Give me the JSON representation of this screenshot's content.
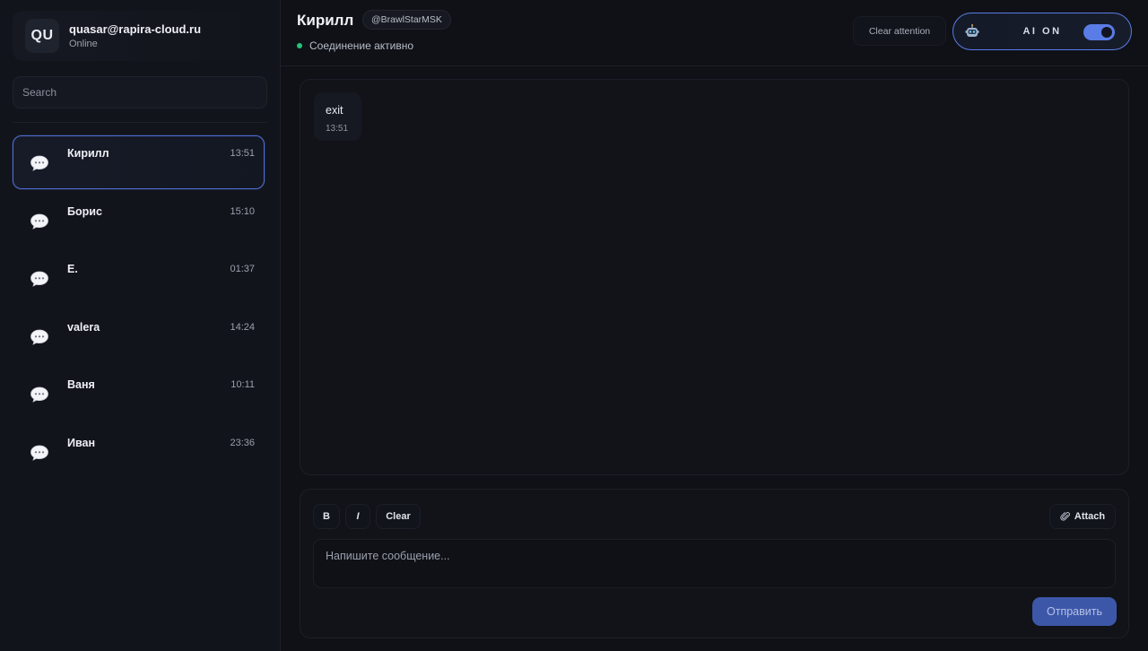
{
  "profile": {
    "avatar_initials": "QU",
    "email": "quasar@rapira-cloud.ru",
    "status": "Online"
  },
  "search": {
    "placeholder": "Search"
  },
  "chats": [
    {
      "name": "Кирилл",
      "time": "13:51",
      "active": true,
      "icon": "speech-bubble-icon"
    },
    {
      "name": "Борис",
      "time": "15:10",
      "active": false,
      "icon": "speech-bubble-icon"
    },
    {
      "name": "Е.",
      "time": "01:37",
      "active": false,
      "icon": "speech-bubble-icon"
    },
    {
      "name": "valera",
      "time": "14:24",
      "active": false,
      "icon": "speech-bubble-icon"
    },
    {
      "name": "Ваня",
      "time": "10:11",
      "active": false,
      "icon": "speech-bubble-icon"
    },
    {
      "name": "Иван",
      "time": "23:36",
      "active": false,
      "icon": "speech-bubble-icon"
    }
  ],
  "header": {
    "contact_name": "Кирилл",
    "handle": "@BrawlStarMSK",
    "connection_status": "Соединение активно",
    "clear_attention_label": "Clear attention",
    "ai_label": "AI ON",
    "ai_enabled": true
  },
  "messages": [
    {
      "text": "exit",
      "time": "13:51"
    }
  ],
  "composer": {
    "bold_label": "B",
    "italic_label": "I",
    "clear_label": "Clear",
    "attach_label": "Attach",
    "input_placeholder": "Напишите сообщение...",
    "send_label": "Отправить"
  },
  "colors": {
    "accent": "#5a7ce6",
    "online": "#27c47a",
    "send_button": "#3d57a8",
    "background": "#0f1117"
  }
}
